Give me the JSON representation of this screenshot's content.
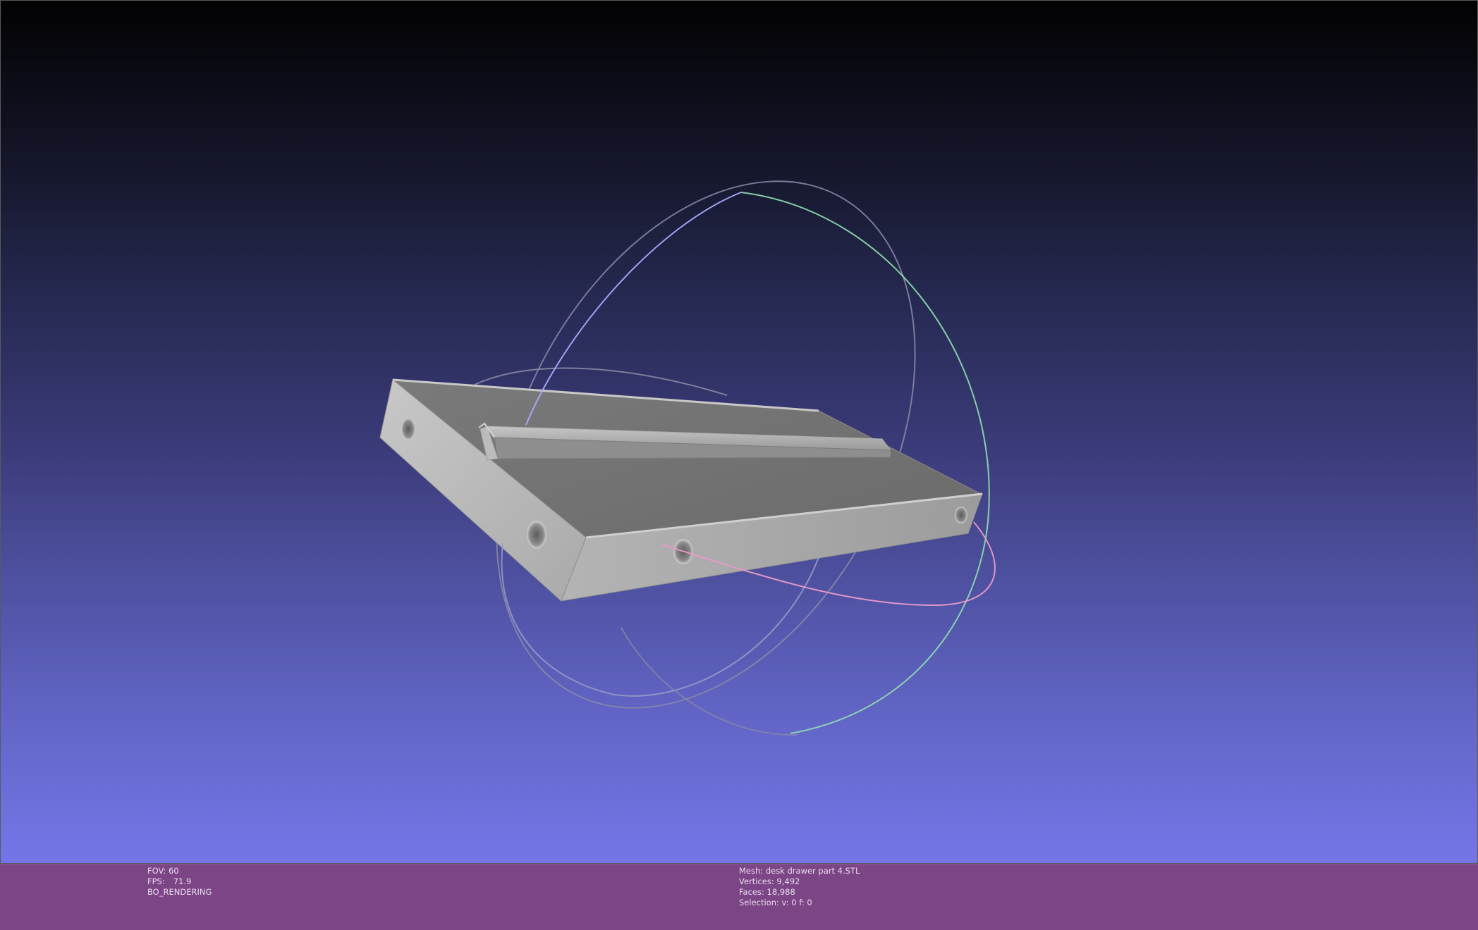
{
  "viewport": {
    "background_top": "#020203",
    "background_bottom": "#7476e8",
    "mesh_color": "#a8a8a8",
    "trackball_colors": {
      "x_ring": "#e79ac8",
      "y_ring": "#8fe0b0",
      "z_ring": "#9a9cf2"
    }
  },
  "info_left": {
    "fov_label": "FOV:",
    "fov_value": "60",
    "fps_label": "FPS:",
    "fps_value": "71.9",
    "render_mode": "BO_RENDERING"
  },
  "info_right": {
    "mesh_label": "Mesh:",
    "mesh_value": "desk drawer part 4.STL",
    "vertices_label": "Vertices:",
    "vertices_value": "9,492",
    "faces_label": "Faces:",
    "faces_value": "18,988",
    "selection_label": "Selection:",
    "selection_value": "v: 0 f: 0"
  },
  "info_bar_color": "#7c4585"
}
